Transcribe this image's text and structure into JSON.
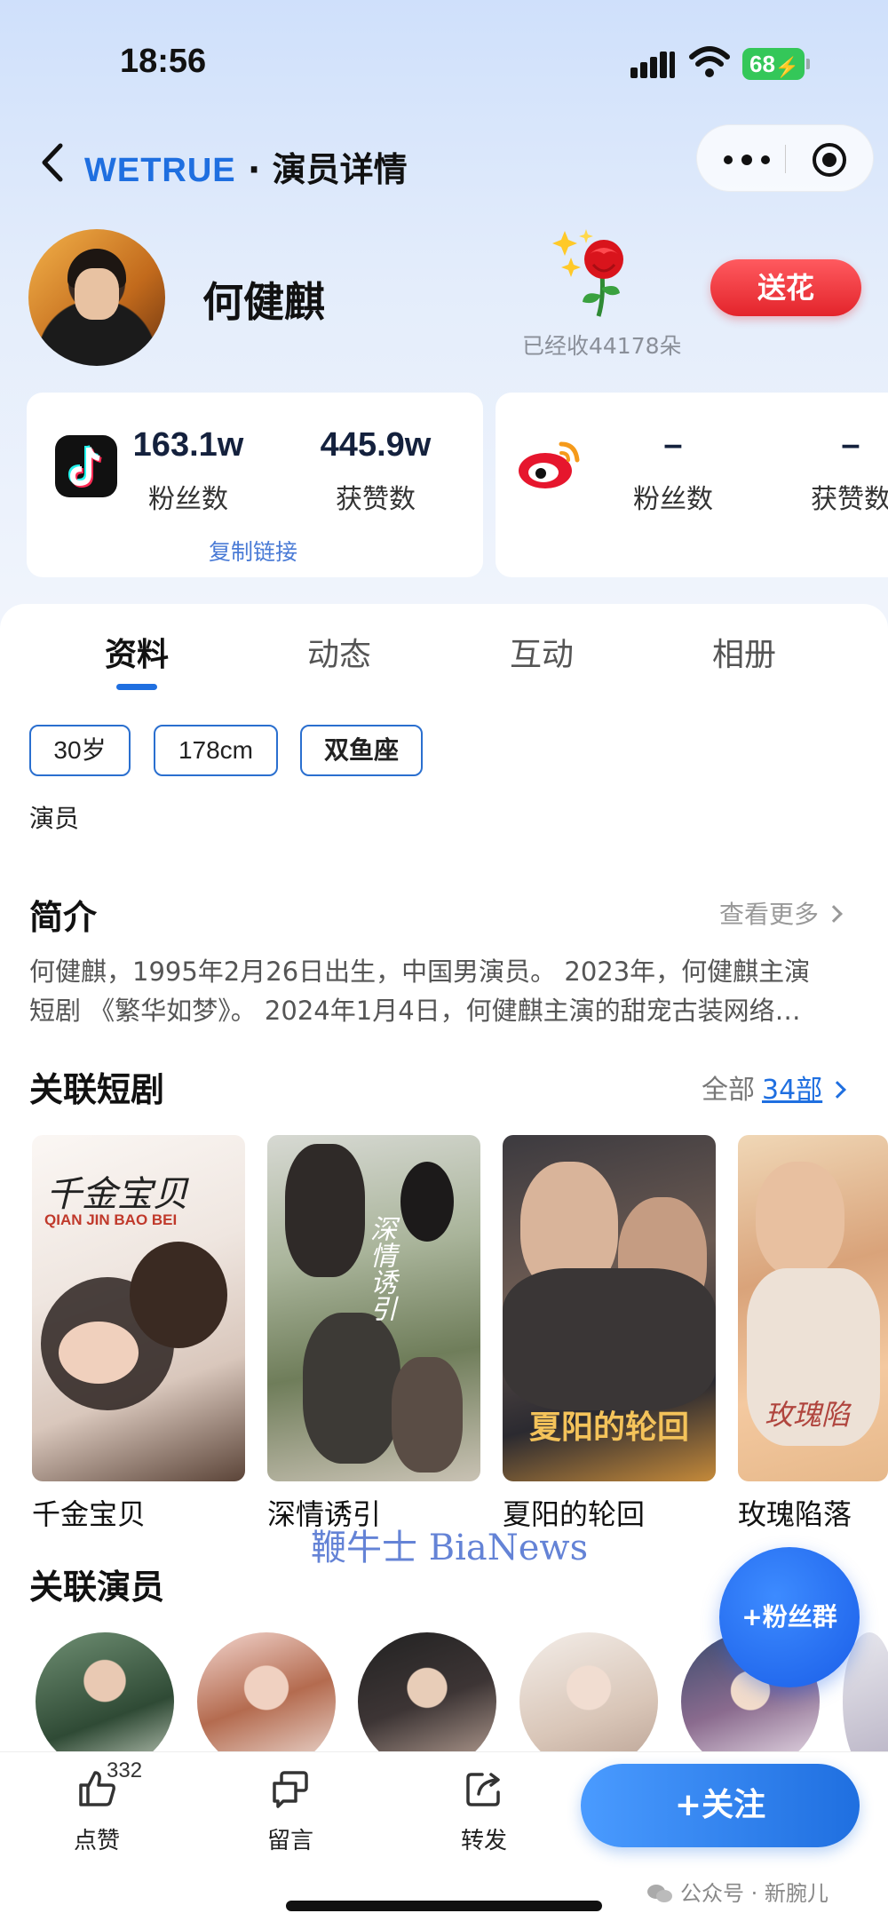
{
  "status_bar": {
    "time": "18:56",
    "battery": "68"
  },
  "nav": {
    "brand": "WETRUE",
    "separator": " · ",
    "title": "演员详情"
  },
  "profile": {
    "name": "何健麒",
    "flowers_received": "已经收44178朵",
    "gift_button": "送花"
  },
  "douyin": {
    "fans_value": "163.1w",
    "fans_label": "粉丝数",
    "likes_value": "445.9w",
    "likes_label": "获赞数",
    "copy_link": "复制链接"
  },
  "weibo": {
    "fans_value": "–",
    "fans_label": "粉丝数",
    "likes_value": "–",
    "likes_label": "获赞数"
  },
  "tabs": [
    {
      "label": "资料"
    },
    {
      "label": "动态"
    },
    {
      "label": "互动"
    },
    {
      "label": "相册"
    }
  ],
  "tags": [
    "30岁",
    "178cm",
    "双鱼座"
  ],
  "profession": "演员",
  "intro": {
    "title": "简介",
    "see_more": "查看更多",
    "line1": "何健麒，1995年2月26日出生，中国男演员。 2023年，何健麒主演",
    "line2": "短剧 《繁华如梦》。 2024年1月4日，何健麒主演的甜宠古装网络…"
  },
  "dramas": {
    "title": "关联短剧",
    "all_label": "全部",
    "count": "34部",
    "items": [
      {
        "title": "千金宝贝",
        "poster_text": "千金宝贝",
        "poster_sub": "QIAN JIN BAO BEI"
      },
      {
        "title": "深情诱引",
        "poster_text": "深情诱引"
      },
      {
        "title": "夏阳的轮回",
        "poster_text": "夏阳的轮回"
      },
      {
        "title": "玫瑰陷落",
        "poster_text": "玫瑰陷"
      }
    ]
  },
  "watermark": "鞭牛士 BiaNews",
  "actors": {
    "title": "关联演员"
  },
  "fan_group": "+粉丝群",
  "bottom_bar": {
    "like_label": "点赞",
    "like_count": "332",
    "comment_label": "留言",
    "share_label": "转发",
    "follow": "+关注"
  },
  "footer_mark": "公众号 · 新腕儿",
  "colors": {
    "accent": "#1f6fe0",
    "gift": "#e3242b",
    "battery": "#34c759"
  }
}
